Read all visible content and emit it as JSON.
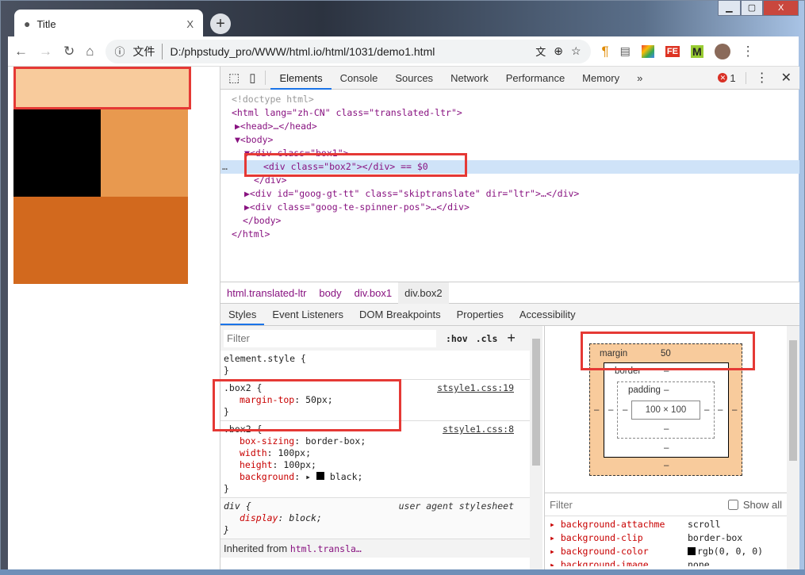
{
  "window": {
    "controls": [
      "minimize",
      "maximize",
      "close"
    ],
    "close_label": "X"
  },
  "tab": {
    "title": "Title",
    "close": "X",
    "new_tab": "+"
  },
  "toolbar": {
    "file_label": "文件",
    "url": "D:/phpstudy_pro/WWW/html.io/html/1031/demo1.html"
  },
  "page": {
    "colors": {
      "box_margin": "#f8cb9c",
      "box2": "#000000",
      "box1": "#e8994f",
      "bottom": "#d2691e"
    }
  },
  "devtools": {
    "tabs": [
      "Elements",
      "Console",
      "Sources",
      "Network",
      "Performance",
      "Memory"
    ],
    "more": "»",
    "errors": "1",
    "close": "✕",
    "dom": [
      {
        "html": "<span class='gray'>&lt;!doctype html&gt;</span>"
      },
      {
        "html": "<span class='tag'>&lt;html</span> <span class='attr'>lang</span>=<span class='val'>\"zh-CN\"</span> <span class='attr'>class</span>=<span class='val'>\"translated-ltr\"</span><span class='tag'>&gt;</span>"
      }
    ],
    "dom_lines": [
      "<!doctype html>",
      "<html lang=\"zh-CN\" class=\"translated-ltr\">",
      "▶<head>…</head>",
      "▼<body>",
      "▼<div class=\"box1\">",
      "<div class=\"box2\"></div> == $0",
      "</div>",
      "▶<div id=\"goog-gt-tt\" class=\"skiptranslate\" dir=\"ltr\">…</div>",
      "▶<div class=\"goog-te-spinner-pos\">…</div>",
      "</body>",
      "</html>"
    ],
    "breadcrumbs": [
      "html.translated-ltr",
      "body",
      "div.box1",
      "div.box2"
    ],
    "subtabs": [
      "Styles",
      "Event Listeners",
      "DOM Breakpoints",
      "Properties",
      "Accessibility"
    ],
    "styles": {
      "filter_placeholder": "Filter",
      "hov": ":hov",
      "cls": ".cls",
      "add": "+",
      "element_style": "element.style {",
      "close_brace": "}",
      "rule1": {
        "selector": ".box2 {",
        "source": "stsyle1.css:19",
        "props": [
          [
            "margin-top",
            "50px;"
          ]
        ]
      },
      "rule2": {
        "selector": ".box2 {",
        "source": "stsyle1.css:8",
        "props": [
          [
            "box-sizing",
            "border-box;"
          ],
          [
            "width",
            "100px;"
          ],
          [
            "height",
            "100px;"
          ],
          [
            "background",
            "black;"
          ]
        ]
      },
      "rule3": {
        "selector": "div {",
        "source": "user agent stylesheet",
        "props": [
          [
            "display",
            "block;"
          ]
        ]
      },
      "inherited_label": "Inherited from",
      "inherited_from": "html.transla…"
    },
    "box_model": {
      "margin_label": "margin",
      "margin_top": "50",
      "border_label": "border",
      "padding_label": "padding",
      "dash": "–",
      "content": "100 × 100"
    },
    "computed": {
      "filter_placeholder": "Filter",
      "show_all": "Show all",
      "show_all_checked": false,
      "props": [
        [
          "background-attachme",
          "scroll"
        ],
        [
          "background-clip",
          "border-box"
        ],
        [
          "background-color",
          "rgb(0, 0, 0)"
        ],
        [
          "background-image",
          "none"
        ]
      ]
    }
  }
}
